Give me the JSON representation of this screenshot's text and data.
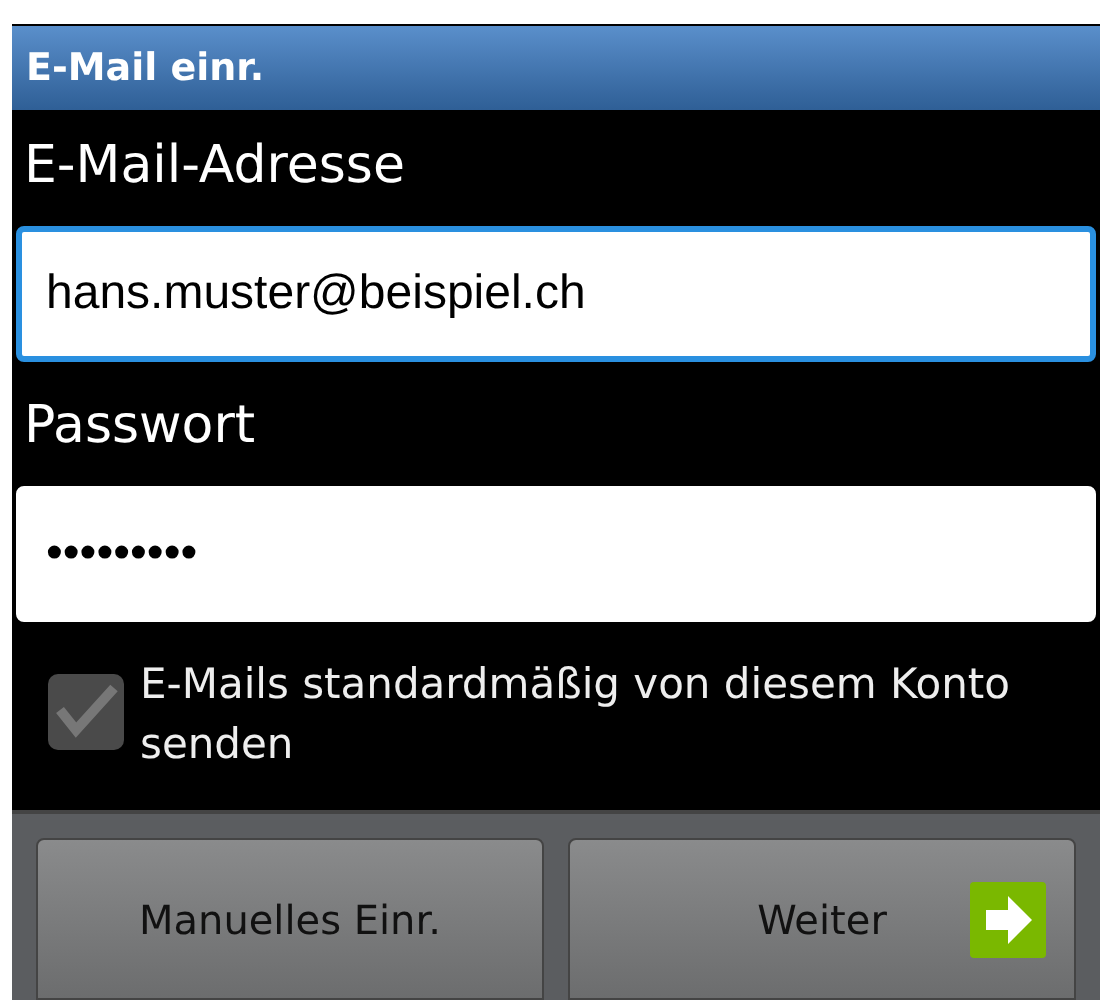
{
  "window": {
    "title": "E-Mail einr."
  },
  "fields": [
    {
      "label": "E-Mail-Adresse",
      "value": "hans.muster@beispiel.ch",
      "focused": true
    },
    {
      "label": "Passwort",
      "value": "•••••••••",
      "focused": false
    }
  ],
  "checkbox": {
    "label": "E-Mails standardmäßig von diesem Konto senden",
    "checked": true,
    "disabled": true
  },
  "buttons": [
    {
      "label": "Manuelles Einr.",
      "kind": "plain"
    },
    {
      "label": "Weiter",
      "kind": "next"
    }
  ]
}
